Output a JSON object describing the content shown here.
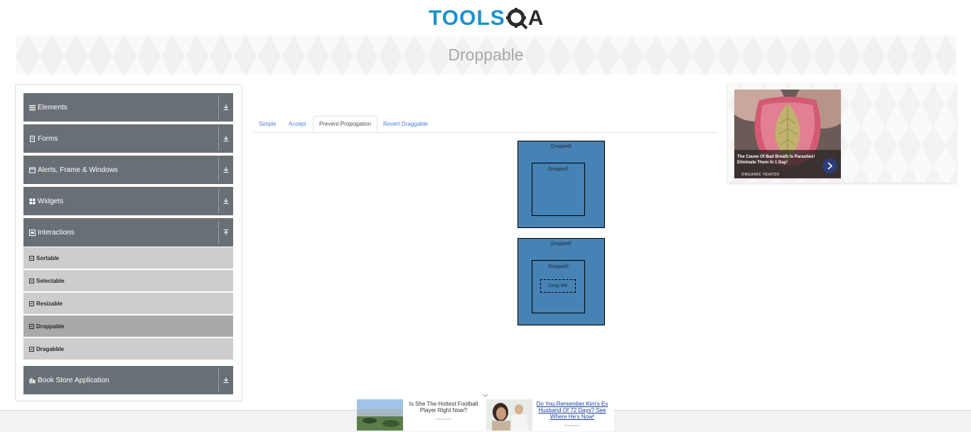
{
  "header": {
    "logo_left": "TOOLS",
    "logo_right": "A",
    "page_title": "Droppable"
  },
  "sidebar": {
    "groups": [
      {
        "label": "Elements",
        "icon": "hamburger-icon"
      },
      {
        "label": "Forms",
        "icon": "file-icon"
      },
      {
        "label": "Alerts, Frame & Windows",
        "icon": "window-icon"
      },
      {
        "label": "Widgets",
        "icon": "grid-icon"
      },
      {
        "label": "Interactions",
        "icon": "interactions-icon"
      },
      {
        "label": "Book Store Application",
        "icon": "book-icon"
      }
    ],
    "items": [
      {
        "label": "Sortable"
      },
      {
        "label": "Selectable"
      },
      {
        "label": "Resizable"
      },
      {
        "label": "Droppable"
      },
      {
        "label": "Dragabble"
      }
    ]
  },
  "tabs": [
    {
      "label": "Simple"
    },
    {
      "label": "Accept"
    },
    {
      "label": "Prevent Propogation"
    },
    {
      "label": "Revert Draggable"
    }
  ],
  "drop_area": {
    "box1_outer": "Dropped!",
    "box1_inner": "Dropped!",
    "box2_outer": "Dropped!",
    "box2_inner": "Dropped!",
    "drag_label": "Drag Me"
  },
  "ad_right": {
    "text": "The Cause Of Bad Breath Is Parasites! Eliminate Them In 1 Day!",
    "brand": "ORGANIC TEATOX"
  },
  "ad_bottom": {
    "left_text": "Is She The Hottest Football Player Right Now?",
    "left_source": "Brainberries",
    "right_text": "Do You Remember Kim's Ex Husband Of 72 Days? See Where He's Now!",
    "right_source": "Brainberries"
  },
  "colors": {
    "accent": "#4682b4",
    "menu_header": "#687076",
    "menu_item": "#cdcdcd",
    "menu_item_active": "#a9a9a9",
    "tab_link": "#4a7fd1"
  }
}
